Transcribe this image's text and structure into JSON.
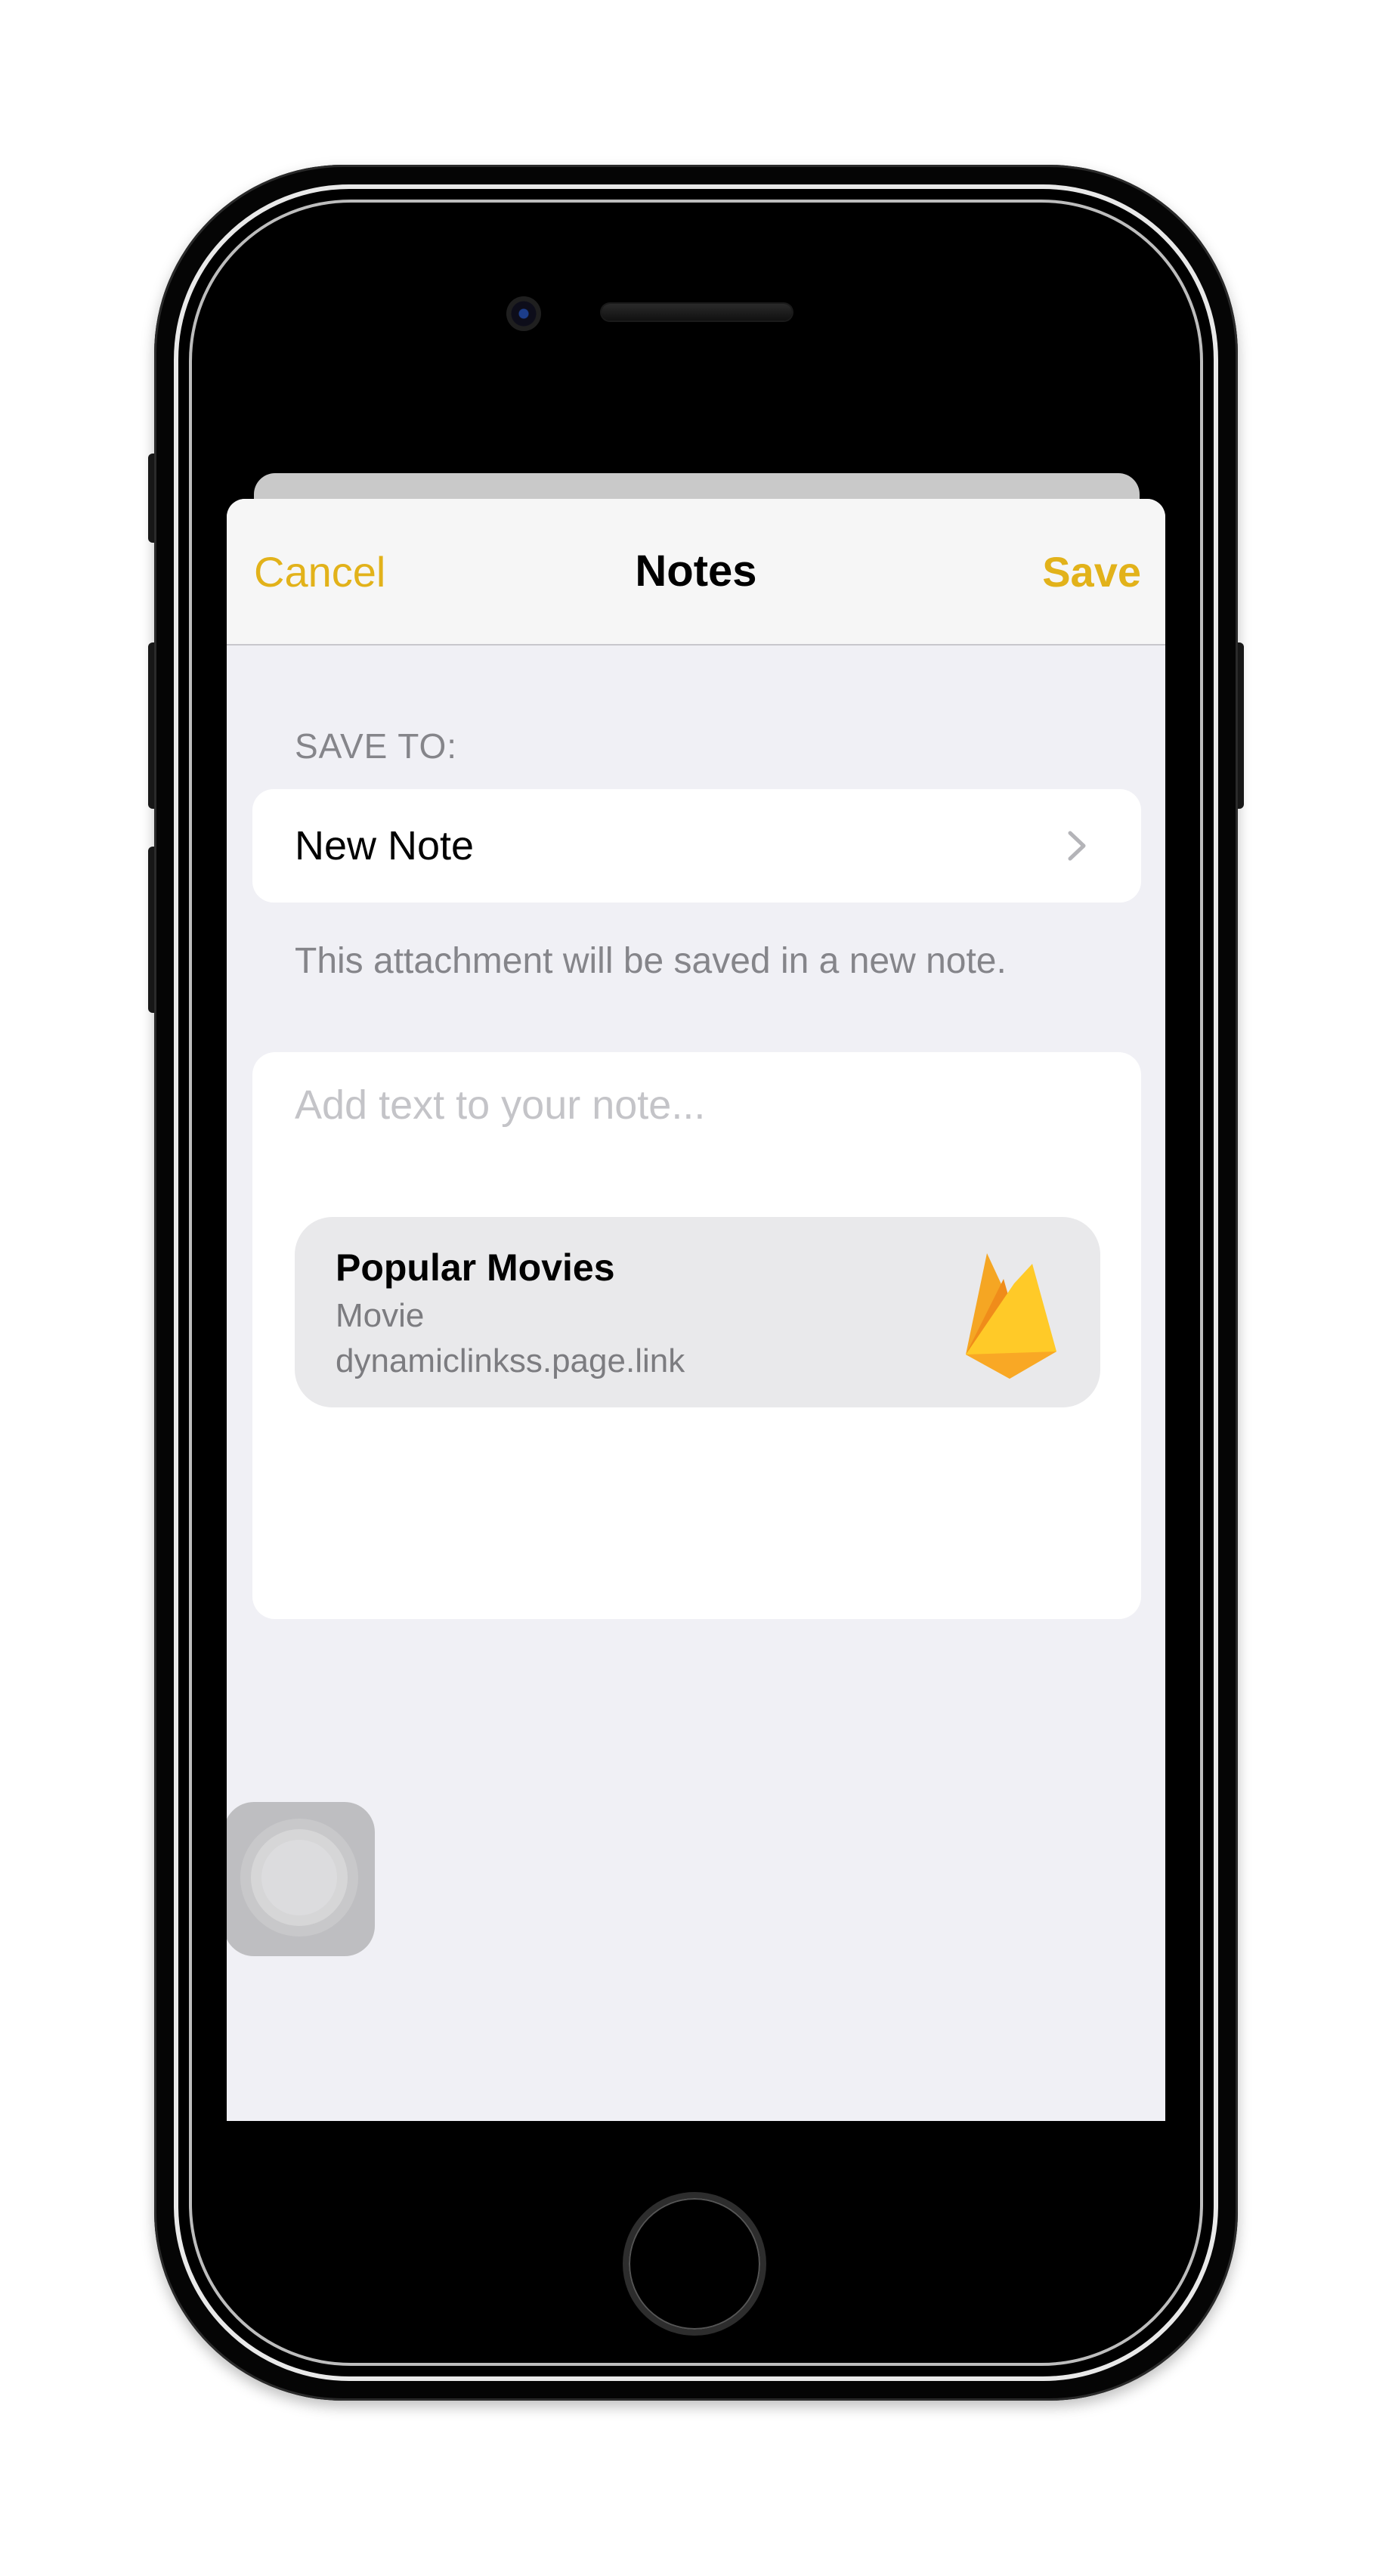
{
  "navbar": {
    "cancel_label": "Cancel",
    "title": "Notes",
    "save_label": "Save"
  },
  "save_to": {
    "header": "SAVE TO:",
    "destination": "New Note",
    "footer": "This attachment will be saved in a new note."
  },
  "note": {
    "placeholder": "Add text to your note...",
    "value": "",
    "attachment": {
      "title": "Popular Movies",
      "subtitle": "Movie",
      "url": "dynamiclinkss.page.link",
      "icon": "firebase-icon"
    }
  },
  "colors": {
    "accent": "#e2b21a",
    "background": "#f0f0f5",
    "secondary_text": "#85858a",
    "placeholder": "#c4c4c8"
  },
  "icons": {
    "chevron": "chevron-right-icon",
    "assistive_touch": "assistive-touch-icon"
  }
}
